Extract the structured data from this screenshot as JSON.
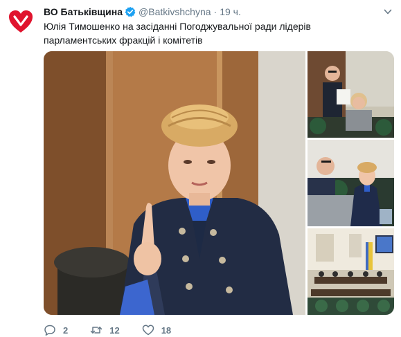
{
  "account": {
    "display_name": "ВО Батьківщина",
    "handle": "@Batkivshchyna",
    "separator": "·",
    "time": "19 ч.",
    "avatar_icon": "red-heart-logo",
    "verified_icon": "verified-badge-icon"
  },
  "tweet": {
    "text_line1": "Юлія Тимошенко на засіданні Погоджувальної ради лідерів",
    "text_line2": "парламентських фракцій і комітетів"
  },
  "actions": {
    "reply": {
      "icon": "reply-icon",
      "count": "2"
    },
    "retweet": {
      "icon": "retweet-icon",
      "count": "12"
    },
    "like": {
      "icon": "heart-icon",
      "count": "18"
    }
  },
  "colors": {
    "brand_red": "#e0142e",
    "verified_blue": "#1da1f2",
    "text": "#14171a",
    "muted": "#657786"
  }
}
